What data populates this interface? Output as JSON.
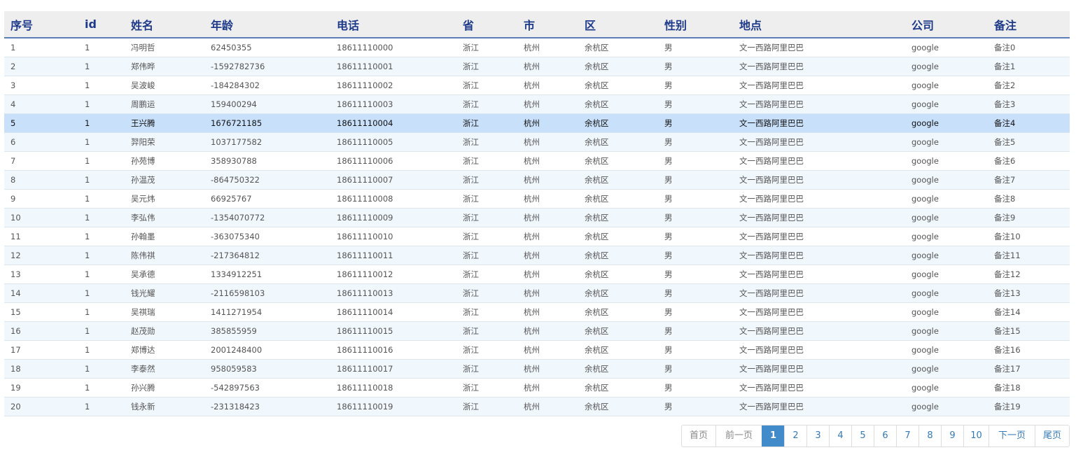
{
  "table": {
    "headers": [
      "序号",
      "id",
      "姓名",
      "年龄",
      "电话",
      "省",
      "市",
      "区",
      "性别",
      "地点",
      "公司",
      "备注"
    ],
    "selected_index": 4,
    "rows": [
      [
        "1",
        "1",
        "冯明哲",
        "62450355",
        "18611110000",
        "浙江",
        "杭州",
        "余杭区",
        "男",
        "文一西路阿里巴巴",
        "google",
        "备注0"
      ],
      [
        "2",
        "1",
        "郑伟晔",
        "-1592782736",
        "18611110001",
        "浙江",
        "杭州",
        "余杭区",
        "男",
        "文一西路阿里巴巴",
        "google",
        "备注1"
      ],
      [
        "3",
        "1",
        "吴波峻",
        "-184284302",
        "18611110002",
        "浙江",
        "杭州",
        "余杭区",
        "男",
        "文一西路阿里巴巴",
        "google",
        "备注2"
      ],
      [
        "4",
        "1",
        "周鹏运",
        "159400294",
        "18611110003",
        "浙江",
        "杭州",
        "余杭区",
        "男",
        "文一西路阿里巴巴",
        "google",
        "备注3"
      ],
      [
        "5",
        "1",
        "王兴腾",
        "1676721185",
        "18611110004",
        "浙江",
        "杭州",
        "余杭区",
        "男",
        "文一西路阿里巴巴",
        "google",
        "备注4"
      ],
      [
        "6",
        "1",
        "羿阳荣",
        "1037177582",
        "18611110005",
        "浙江",
        "杭州",
        "余杭区",
        "男",
        "文一西路阿里巴巴",
        "google",
        "备注5"
      ],
      [
        "7",
        "1",
        "孙苑博",
        "358930788",
        "18611110006",
        "浙江",
        "杭州",
        "余杭区",
        "男",
        "文一西路阿里巴巴",
        "google",
        "备注6"
      ],
      [
        "8",
        "1",
        "孙温茂",
        "-864750322",
        "18611110007",
        "浙江",
        "杭州",
        "余杭区",
        "男",
        "文一西路阿里巴巴",
        "google",
        "备注7"
      ],
      [
        "9",
        "1",
        "吴元炜",
        "66925767",
        "18611110008",
        "浙江",
        "杭州",
        "余杭区",
        "男",
        "文一西路阿里巴巴",
        "google",
        "备注8"
      ],
      [
        "10",
        "1",
        "李弘伟",
        "-1354070772",
        "18611110009",
        "浙江",
        "杭州",
        "余杭区",
        "男",
        "文一西路阿里巴巴",
        "google",
        "备注9"
      ],
      [
        "11",
        "1",
        "孙翰墨",
        "-363075340",
        "18611110010",
        "浙江",
        "杭州",
        "余杭区",
        "男",
        "文一西路阿里巴巴",
        "google",
        "备注10"
      ],
      [
        "12",
        "1",
        "陈伟祺",
        "-217364812",
        "18611110011",
        "浙江",
        "杭州",
        "余杭区",
        "男",
        "文一西路阿里巴巴",
        "google",
        "备注11"
      ],
      [
        "13",
        "1",
        "吴承德",
        "1334912251",
        "18611110012",
        "浙江",
        "杭州",
        "余杭区",
        "男",
        "文一西路阿里巴巴",
        "google",
        "备注12"
      ],
      [
        "14",
        "1",
        "钱光耀",
        "-2116598103",
        "18611110013",
        "浙江",
        "杭州",
        "余杭区",
        "男",
        "文一西路阿里巴巴",
        "google",
        "备注13"
      ],
      [
        "15",
        "1",
        "吴祺瑞",
        "1411271954",
        "18611110014",
        "浙江",
        "杭州",
        "余杭区",
        "男",
        "文一西路阿里巴巴",
        "google",
        "备注14"
      ],
      [
        "16",
        "1",
        "赵茂勋",
        "385855959",
        "18611110015",
        "浙江",
        "杭州",
        "余杭区",
        "男",
        "文一西路阿里巴巴",
        "google",
        "备注15"
      ],
      [
        "17",
        "1",
        "郑博达",
        "2001248400",
        "18611110016",
        "浙江",
        "杭州",
        "余杭区",
        "男",
        "文一西路阿里巴巴",
        "google",
        "备注16"
      ],
      [
        "18",
        "1",
        "李泰然",
        "958059583",
        "18611110017",
        "浙江",
        "杭州",
        "余杭区",
        "男",
        "文一西路阿里巴巴",
        "google",
        "备注17"
      ],
      [
        "19",
        "1",
        "孙兴腾",
        "-542897563",
        "18611110018",
        "浙江",
        "杭州",
        "余杭区",
        "男",
        "文一西路阿里巴巴",
        "google",
        "备注18"
      ],
      [
        "20",
        "1",
        "钱永新",
        "-231318423",
        "18611110019",
        "浙江",
        "杭州",
        "余杭区",
        "男",
        "文一西路阿里巴巴",
        "google",
        "备注19"
      ]
    ]
  },
  "pagination": {
    "first": "首页",
    "prev": "前一页",
    "pages": [
      "1",
      "2",
      "3",
      "4",
      "5",
      "6",
      "7",
      "8",
      "9",
      "10"
    ],
    "current_page": "1",
    "next": "下一页",
    "last": "尾页"
  },
  "colors": {
    "header_text": "#1e3a8a",
    "header_bg": "#eeeeee",
    "row_alt_bg": "#f0f7fd",
    "row_selected_bg": "#c9e0fa",
    "pager_active_bg": "#428bca",
    "pager_link": "#337ab7"
  }
}
